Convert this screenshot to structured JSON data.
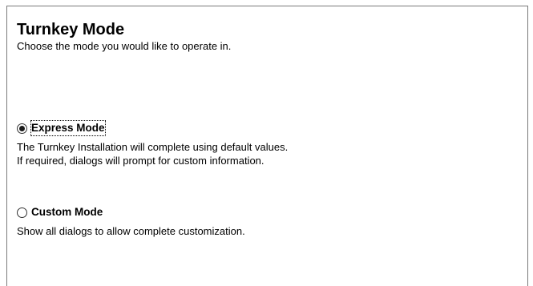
{
  "header": {
    "title": "Turnkey Mode",
    "subtitle": "Choose the mode you would like to operate in."
  },
  "options": [
    {
      "label": "Express Mode",
      "selected": true,
      "focused": true,
      "description_lines": [
        "The Turnkey Installation will complete using default values.",
        "If required, dialogs will prompt for custom information."
      ]
    },
    {
      "label": "Custom Mode",
      "selected": false,
      "focused": false,
      "description_lines": [
        "Show all dialogs to allow complete customization."
      ]
    }
  ]
}
